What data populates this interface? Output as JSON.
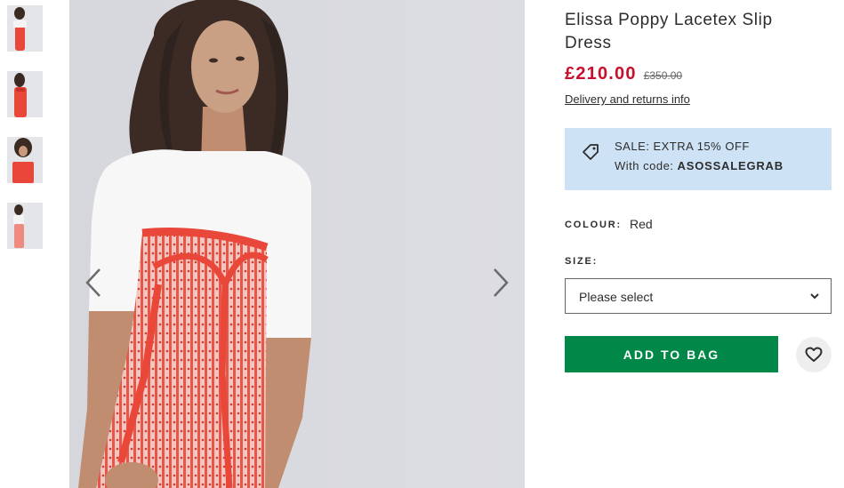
{
  "product": {
    "title": "Elissa Poppy Lacetex Slip Dress",
    "price_now": "£210.00",
    "price_was": "£350.00",
    "delivery_link": "Delivery and returns info"
  },
  "promo": {
    "line1": "SALE: EXTRA 15% OFF",
    "line2_prefix": "With code: ",
    "code": "ASOSSALEGRAB",
    "icon": "price-tag-icon",
    "background": "#cde2f5"
  },
  "colour": {
    "label": "COLOUR:",
    "value": "Red"
  },
  "size": {
    "label": "SIZE:",
    "placeholder": "Please select",
    "icon": "chevron-down-icon"
  },
  "actions": {
    "add_to_bag": "ADD TO BAG",
    "save_icon": "heart-icon"
  },
  "gallery": {
    "thumbnail_count": 4,
    "prev_icon": "chevron-left-icon",
    "next_icon": "chevron-right-icon"
  },
  "colors": {
    "price": "#c8102e",
    "button": "#018849",
    "dress": "#e8473a"
  }
}
